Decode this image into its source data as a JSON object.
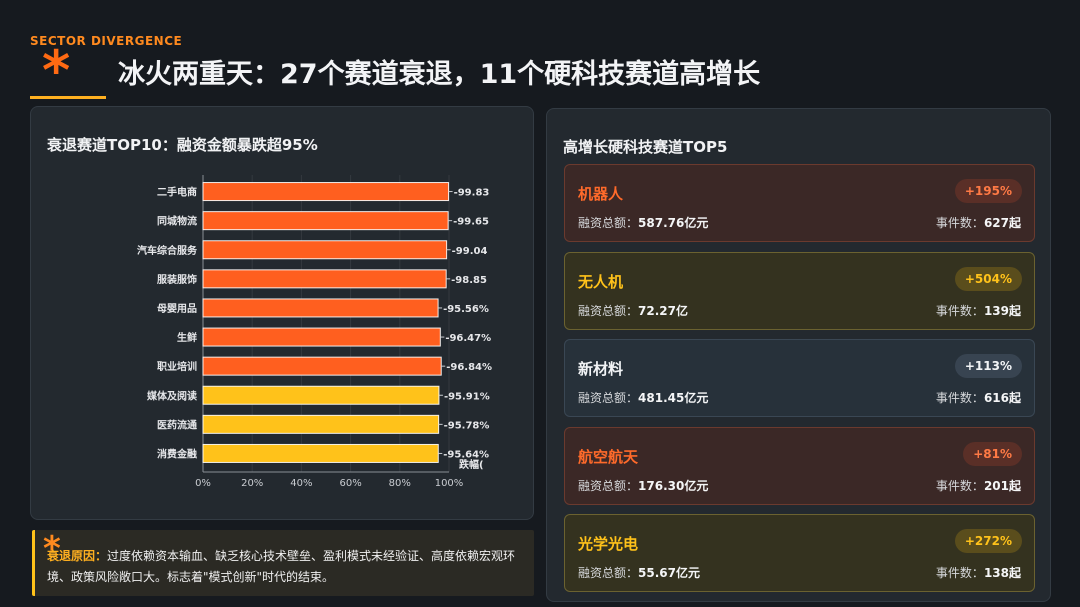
{
  "header": {
    "eyebrow": "SECTOR DIVERGENCE",
    "title": "冰火两重天：27个赛道衰退，11个硬科技赛道高增长"
  },
  "left_panel": {
    "title": "衰退赛道TOP10：融资金额暴跌超95%"
  },
  "chart_data": {
    "type": "bar",
    "orientation": "horizontal",
    "title": "衰退赛道TOP10：融资金额暴跌超95%",
    "categories": [
      "二手电商",
      "同城物流",
      "汽车综合服务",
      "服装服饰",
      "母婴用品",
      "生鲜",
      "职业培训",
      "媒体及阅读",
      "医药流通",
      "消费金融"
    ],
    "values": [
      99.83,
      99.65,
      99.04,
      98.85,
      95.56,
      96.47,
      96.84,
      95.91,
      95.78,
      95.64
    ],
    "value_labels": [
      "-99.83",
      "-99.65",
      "-99.04",
      "-98.85",
      "-95.56%",
      "-96.47%",
      "-96.84%",
      "-95.91%",
      "-95.78%",
      "-95.64%"
    ],
    "bar_colors": [
      "#ff5f1f",
      "#ff5f1f",
      "#ff5f1f",
      "#ff5f1f",
      "#ff5f1f",
      "#ff5f1f",
      "#ff5f1f",
      "#ffc21a",
      "#ffc21a",
      "#ffc21a"
    ],
    "x_ticks": [
      "0%",
      "20%",
      "40%",
      "60%",
      "80%",
      "100%"
    ],
    "xlim": [
      0,
      100
    ],
    "xlabel": "跌幅(",
    "grid": true
  },
  "note": {
    "label": "衰退原因：",
    "text": "过度依赖资本输血、缺乏核心技术壁垒、盈利模式未经验证、高度依赖宏观环境、政策风险敞口大。标志着\"模式创新\"时代的结束。"
  },
  "right_panel": {
    "title": "高增长硬科技赛道TOP5",
    "fund_label": "融资总额：",
    "event_label": "事件数：",
    "cards": [
      {
        "name": "机器人",
        "badge": "+195%",
        "fund": "587.76亿元",
        "events": "627起",
        "theme": "orange"
      },
      {
        "name": "无人机",
        "badge": "+504%",
        "fund": "72.27亿",
        "events": "139起",
        "theme": "yellow"
      },
      {
        "name": "新材料",
        "badge": "+113%",
        "fund": "481.45亿元",
        "events": "616起",
        "theme": "blue"
      },
      {
        "name": "航空航天",
        "badge": "+81%",
        "fund": "176.30亿元",
        "events": "201起",
        "theme": "orange"
      },
      {
        "name": "光学光电",
        "badge": "+272%",
        "fund": "55.67亿元",
        "events": "138起",
        "theme": "yellow"
      }
    ]
  },
  "colors": {
    "orange": "#ff5f1f",
    "yellow": "#ffc21a",
    "accent": "#ff8a1f"
  }
}
